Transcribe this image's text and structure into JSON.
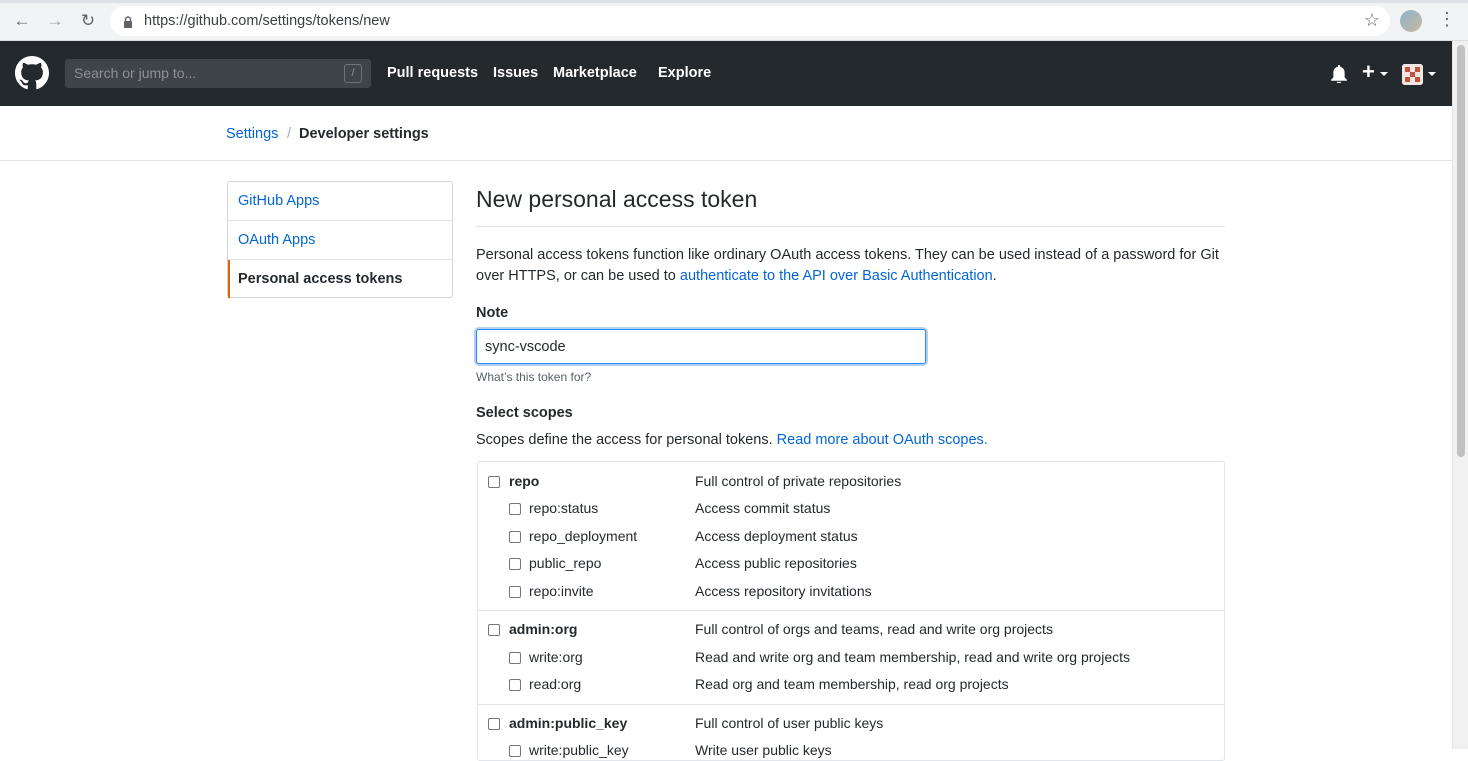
{
  "browser": {
    "url": "https://github.com/settings/tokens/new"
  },
  "header": {
    "search_placeholder": "Search or jump to...",
    "search_shortcut": "/",
    "nav": [
      "Pull requests",
      "Issues",
      "Marketplace",
      "Explore"
    ],
    "new_label": "+"
  },
  "breadcrumb": {
    "parent": "Settings",
    "separator": "/",
    "current": "Developer settings"
  },
  "sidebar": {
    "items": [
      {
        "label": "GitHub Apps"
      },
      {
        "label": "OAuth Apps"
      },
      {
        "label": "Personal access tokens"
      }
    ]
  },
  "main": {
    "title": "New personal access token",
    "desc_part1": "Personal access tokens function like ordinary OAuth access tokens. They can be used instead of a password for Git over HTTPS, or can be used to ",
    "desc_link": "authenticate to the API over Basic Authentication",
    "desc_end": ".",
    "note_label": "Note",
    "note_value": "sync-vscode",
    "note_hint": "What’s this token for?",
    "scopes_label": "Select scopes",
    "scopes_desc": "Scopes define the access for personal tokens. ",
    "scopes_link": "Read more about OAuth scopes."
  },
  "scopes": {
    "repo": {
      "name": "repo",
      "desc": "Full control of private repositories"
    },
    "repo_status": {
      "name": "repo:status",
      "desc": "Access commit status"
    },
    "repo_deployment": {
      "name": "repo_deployment",
      "desc": "Access deployment status"
    },
    "public_repo": {
      "name": "public_repo",
      "desc": "Access public repositories"
    },
    "repo_invite": {
      "name": "repo:invite",
      "desc": "Access repository invitations"
    },
    "admin_org": {
      "name": "admin:org",
      "desc": "Full control of orgs and teams, read and write org projects"
    },
    "write_org": {
      "name": "write:org",
      "desc": "Read and write org and team membership, read and write org projects"
    },
    "read_org": {
      "name": "read:org",
      "desc": "Read org and team membership, read org projects"
    },
    "admin_public_key": {
      "name": "admin:public_key",
      "desc": "Full control of user public keys"
    },
    "write_public_key": {
      "name": "write:public_key",
      "desc": "Write user public keys"
    }
  }
}
